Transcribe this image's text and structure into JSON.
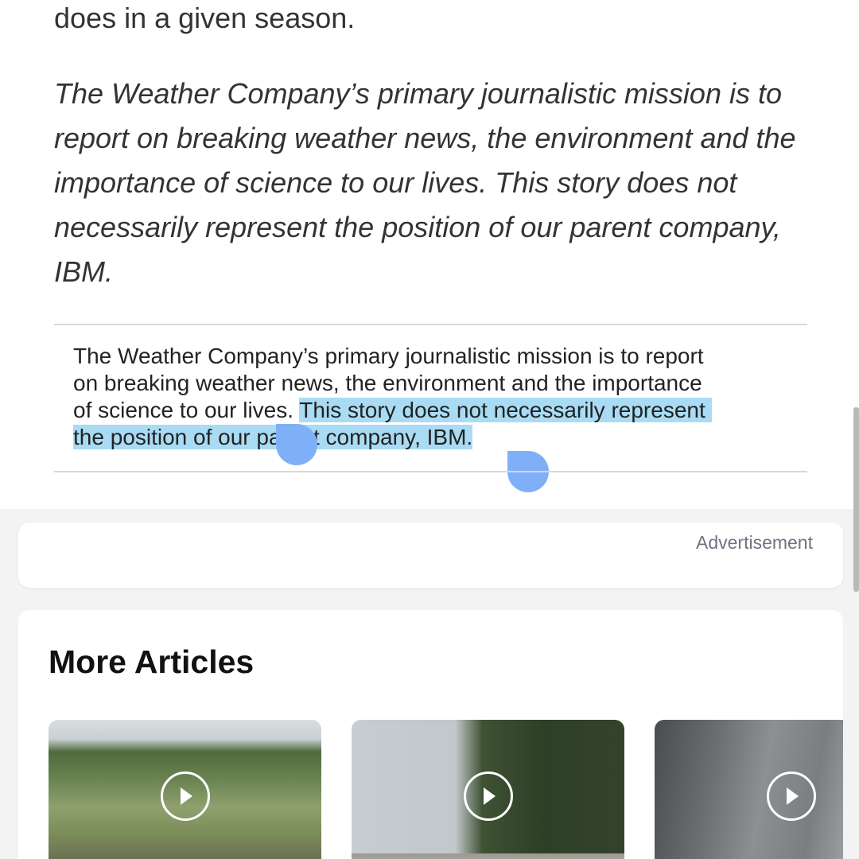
{
  "article": {
    "intro_fragment": "does in a given season.",
    "disclaimer_italic": [
      "The Weather Company’s primary journalistic mission is to",
      "report on breaking weather news, the environment and the",
      "importance of science to our lives. This story does not",
      "necessarily represent the position of our parent company,",
      "IBM."
    ],
    "disclaimer_box": {
      "line1": "The Weather Company’s primary journalistic mission is to report",
      "line2": "on breaking weather news, the environment and the importance",
      "line3_plain": "of science to our lives. ",
      "line3_selected": "This story does not necessarily represent",
      "line4_selected": "the position of our parent company, IBM."
    }
  },
  "advertisement": {
    "label": "Advertisement"
  },
  "more_articles": {
    "title": "More Articles",
    "items": [
      {
        "thumbnail": "flood-grass-village-video",
        "icon": "play-icon"
      },
      {
        "thumbnail": "coastal-cliff-trees-video",
        "icon": "play-icon"
      },
      {
        "thumbnail": "rockfall-cliff-video",
        "icon": "play-icon"
      }
    ]
  },
  "colors": {
    "selection_highlight": "#a9dcf4",
    "selection_handle": "#7fb0f7",
    "text": "#333333",
    "background": "#f3f3f4"
  }
}
